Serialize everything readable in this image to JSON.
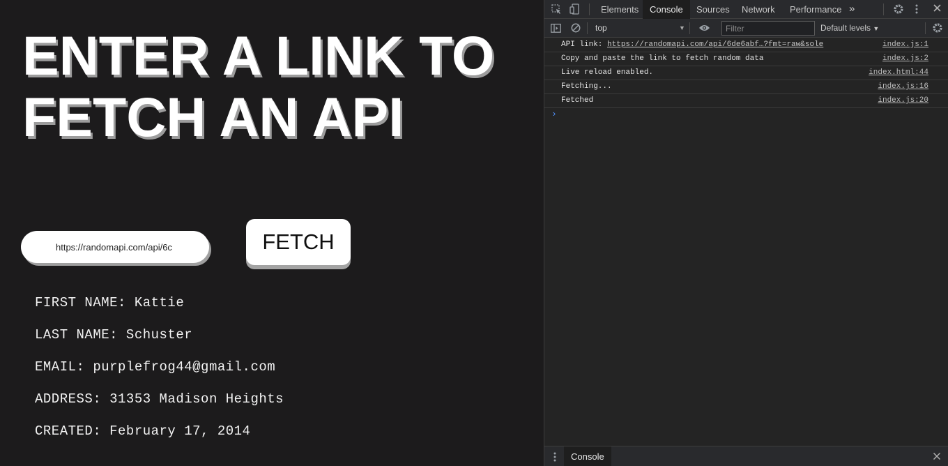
{
  "page": {
    "headline_line1": "ENTER A LINK TO",
    "headline_line2": "FETCH AN API",
    "url_input_value": "https://randomapi.com/api/6c",
    "fetch_label": "FETCH",
    "info": [
      "FIRST NAME: Kattie",
      "LAST NAME: Schuster",
      "EMAIL: purplefrog44@gmail.com",
      "ADDRESS: 31353 Madison Heights",
      "CREATED: February 17, 2014"
    ]
  },
  "devtools": {
    "tabs": [
      "Elements",
      "Console",
      "Sources",
      "Network",
      "Performance"
    ],
    "active_tab": "Console",
    "more_tabs_icon": "chevron-double-right-icon",
    "context": "top",
    "filter_placeholder": "Filter",
    "levels": "Default levels",
    "logs": [
      {
        "prefix": "API link: ",
        "link": "https://randomapi.com/api/6de6abf…?fmt=raw&sole",
        "source": "index.js:1"
      },
      {
        "prefix": "Copy and paste the link to fetch random data",
        "link": "",
        "source": "index.js:2"
      },
      {
        "prefix": "Live reload enabled.",
        "link": "",
        "source": "index.html:44"
      },
      {
        "prefix": "Fetching...",
        "link": "",
        "source": "index.js:16"
      },
      {
        "prefix": "Fetched",
        "link": "",
        "source": "index.js:20"
      }
    ],
    "prompt_glyph": "›",
    "drawer_tab": "Console"
  },
  "colors": {
    "page_bg": "#1c1b1c",
    "devtools_bg": "#242424",
    "prompt_blue": "#4f8ff7"
  }
}
